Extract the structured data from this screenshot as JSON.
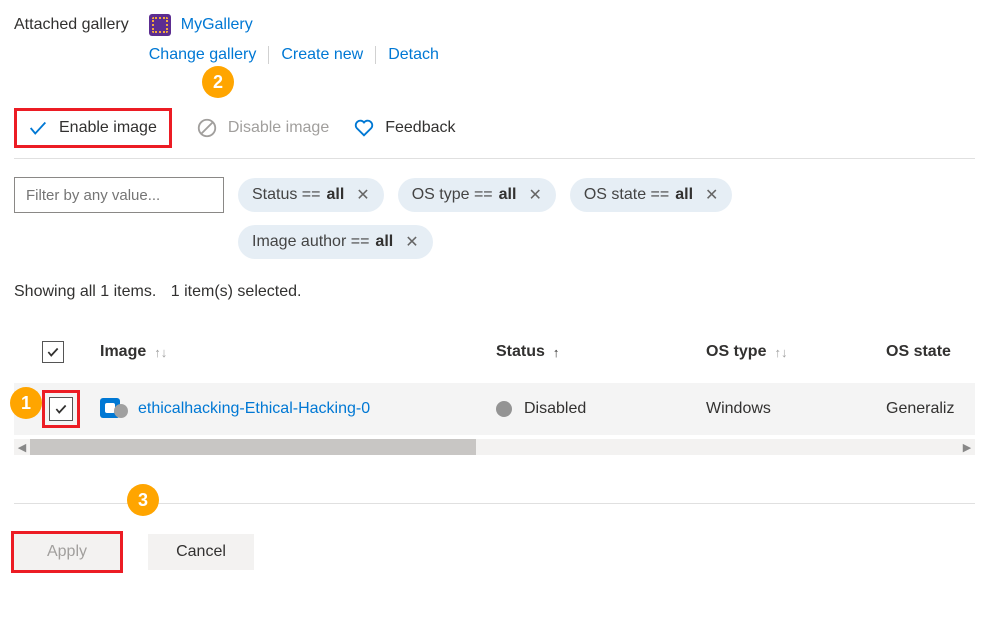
{
  "header": {
    "attached_label": "Attached gallery",
    "gallery_name": "MyGallery",
    "links": {
      "change": "Change gallery",
      "create": "Create new",
      "detach": "Detach"
    }
  },
  "toolbar": {
    "enable_label": "Enable image",
    "disable_label": "Disable image",
    "feedback_label": "Feedback"
  },
  "annotations": {
    "step1": "1",
    "step2": "2",
    "step3": "3"
  },
  "filters": {
    "filter_placeholder": "Filter by any value...",
    "pills": [
      {
        "label": "Status == ",
        "value": "all"
      },
      {
        "label": "OS type == ",
        "value": "all"
      },
      {
        "label": "OS state == ",
        "value": "all"
      },
      {
        "label": "Image author == ",
        "value": "all"
      }
    ]
  },
  "results_text": {
    "showing": "Showing all 1 items.",
    "selected": "1 item(s) selected."
  },
  "table": {
    "columns": {
      "image": "Image",
      "status": "Status",
      "os_type": "OS type",
      "os_state": "OS state"
    },
    "rows": [
      {
        "checked": true,
        "name": "ethicalhacking-Ethical-Hacking-0",
        "status": "Disabled",
        "os_type": "Windows",
        "os_state": "Generaliz"
      }
    ]
  },
  "footer": {
    "apply": "Apply",
    "cancel": "Cancel"
  }
}
